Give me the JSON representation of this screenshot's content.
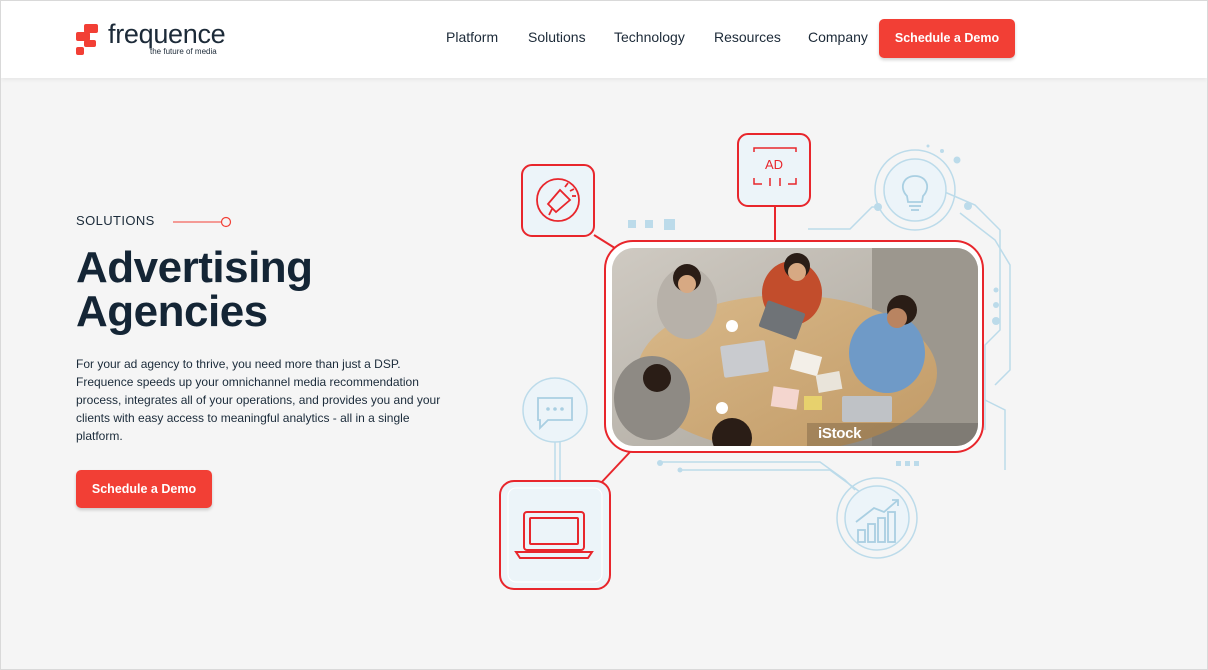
{
  "logo": {
    "wordmark": "frequence",
    "tagline": "the future of media"
  },
  "nav": {
    "items": [
      "Platform",
      "Solutions",
      "Technology",
      "Resources",
      "Company"
    ],
    "cta": "Schedule a Demo"
  },
  "hero": {
    "eyebrow": "SOLUTIONS",
    "title_line1": "Advertising",
    "title_line2": "Agencies",
    "description": "For your ad agency to thrive, you need more than just a DSP. Frequence speeds up your omnichannel media recommendation process, integrates all of your operations, and provides you and your clients with easy access to meaningful analytics - all in a single platform.",
    "cta": "Schedule a Demo"
  },
  "illustration": {
    "ad_label": "AD",
    "photo_watermark": "iStock"
  },
  "colors": {
    "brand_red": "#f23f35",
    "text_dark": "#142535",
    "icon_blue": "#a9cfe2"
  }
}
